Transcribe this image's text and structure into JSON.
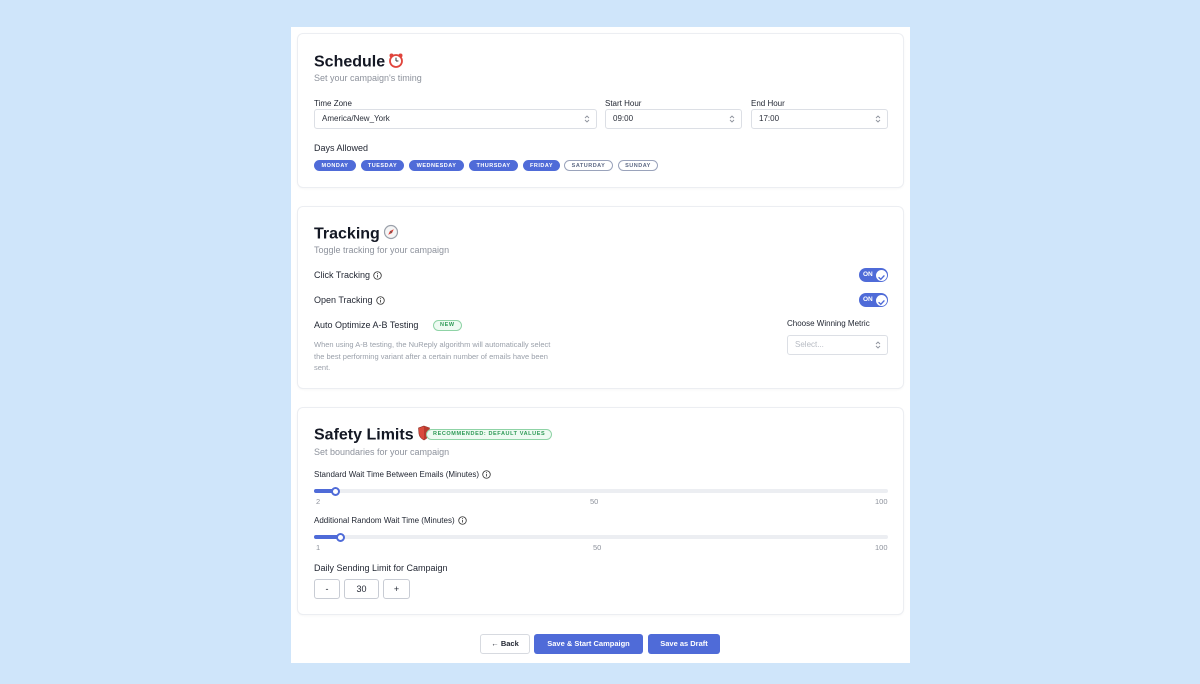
{
  "schedule": {
    "title": "Schedule",
    "subtitle": "Set your campaign's timing",
    "time_zone": {
      "label": "Time Zone",
      "value": "America/New_York"
    },
    "start_hour": {
      "label": "Start Hour",
      "value": "09:00"
    },
    "end_hour": {
      "label": "End Hour",
      "value": "17:00"
    },
    "days_label": "Days Allowed",
    "days": [
      {
        "label": "MONDAY",
        "selected": true
      },
      {
        "label": "TUESDAY",
        "selected": true
      },
      {
        "label": "WEDNESDAY",
        "selected": true
      },
      {
        "label": "THURSDAY",
        "selected": true
      },
      {
        "label": "FRIDAY",
        "selected": true
      },
      {
        "label": "SATURDAY",
        "selected": false
      },
      {
        "label": "SUNDAY",
        "selected": false
      }
    ]
  },
  "tracking": {
    "title": "Tracking",
    "subtitle": "Toggle tracking for your campaign",
    "click_tracking": {
      "label": "Click Tracking",
      "toggle": "ON"
    },
    "open_tracking": {
      "label": "Open Tracking",
      "toggle": "ON"
    },
    "auto_optimize": {
      "label": "Auto Optimize A-B Testing",
      "badge": "NEW",
      "description": "When using A-B testing, the NuReply algorithm will automatically select the best performing variant after a certain number of emails have been sent."
    },
    "winning_metric": {
      "label": "Choose Winning Metric",
      "placeholder": "Select..."
    }
  },
  "safety": {
    "title": "Safety Limits",
    "badge": "RECOMMENDED: DEFAULT VALUES",
    "subtitle": "Set boundaries for your campaign",
    "standard_wait": {
      "label": "Standard Wait Time Between Emails (Minutes)",
      "value": 2,
      "min": "2",
      "mid": "50",
      "max": "100"
    },
    "random_wait": {
      "label": "Additional Random Wait Time (Minutes)",
      "value": 1,
      "min": "1",
      "mid": "50",
      "max": "100"
    },
    "daily_limit": {
      "label": "Daily Sending Limit for Campaign",
      "minus": "-",
      "value": "30",
      "plus": "+"
    }
  },
  "footer": {
    "back": "← Back",
    "save_start": "Save & Start Campaign",
    "save_draft": "Save as Draft"
  },
  "colors": {
    "accent": "#4f6bd8",
    "page_bg": "#cfe5fa",
    "success": "#2f9a57"
  }
}
